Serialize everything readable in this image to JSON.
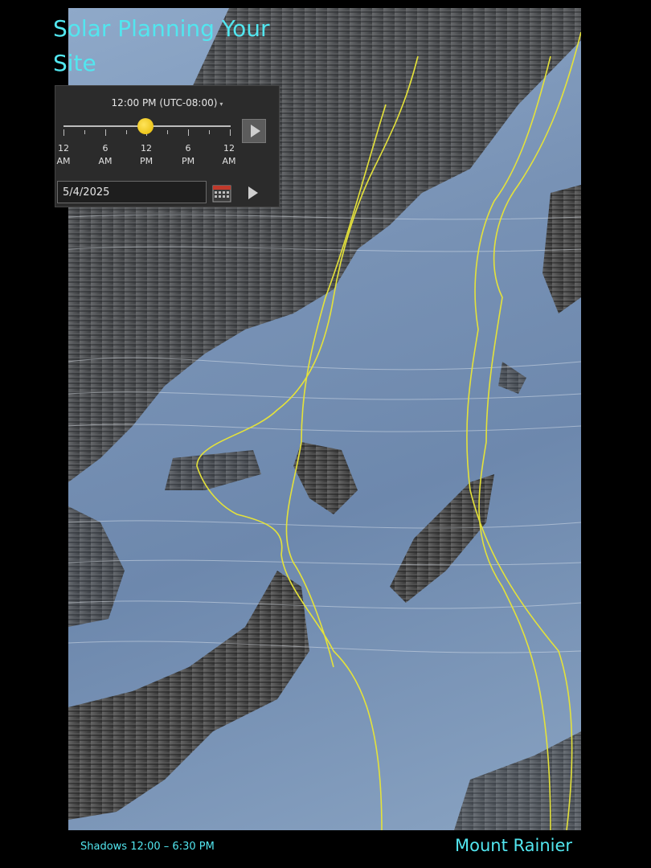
{
  "title": "Solar Planning Your Site",
  "time_panel": {
    "time_label": "12:00 PM (UTC-08:00)",
    "dropdown_caret": "▾",
    "slider_value_fraction": 0.5,
    "tick_labels": [
      {
        "hour": "12",
        "period": "AM"
      },
      {
        "hour": "6",
        "period": "AM"
      },
      {
        "hour": "12",
        "period": "PM"
      },
      {
        "hour": "6",
        "period": "PM"
      },
      {
        "hour": "12",
        "period": "AM"
      }
    ],
    "date_value": "5/4/2025",
    "play_icon": "play-icon",
    "calendar_icon": "calendar-icon"
  },
  "map": {
    "description_icon": "terrain-shadow-map",
    "trail_color": "#e4e23a",
    "shadow_color": "#3c3c3c",
    "lit_color": "#7f9bbf"
  },
  "captions": {
    "left": "Shadows 12:00 – 6:30 PM",
    "right": "Mount Rainier"
  },
  "colors": {
    "accent": "#52e6ef",
    "sun": "#f2c811"
  }
}
